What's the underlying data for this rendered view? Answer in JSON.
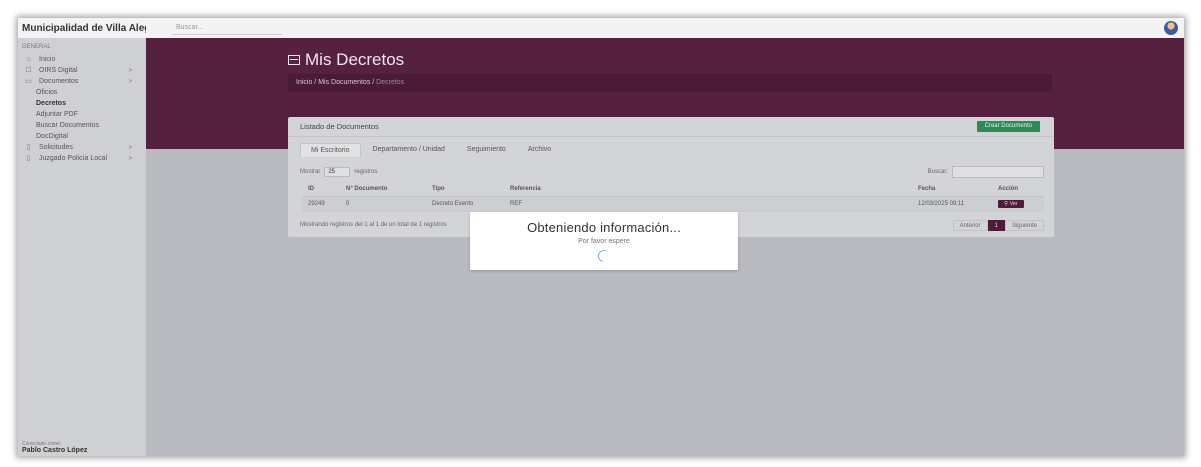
{
  "topbar": {
    "brand": "Municipalidad de Villa Alegre",
    "search_placeholder": "Buscar..."
  },
  "sidebar": {
    "section": "GENERAL",
    "items": [
      {
        "label": "Inicio",
        "icon": "home-icon"
      },
      {
        "label": "OIRS Digital",
        "icon": "inbox-icon",
        "chevron": ">"
      },
      {
        "label": "Documentos",
        "icon": "folder-icon",
        "chevron": ">"
      }
    ],
    "subitems": [
      "Oficios",
      "Decretos",
      "Adjuntar PDF",
      "Buscar Documentos",
      "DocDigital"
    ],
    "active_subitem": "Decretos",
    "items_after": [
      {
        "label": "Solicitudes",
        "icon": "file-icon",
        "chevron": ">"
      },
      {
        "label": "Juzgado Policía Local",
        "icon": "file-icon",
        "chevron": ">"
      }
    ],
    "footer_label": "Conectado como:",
    "footer_user": "Pablo Castro López"
  },
  "page": {
    "title": "Mis Decretos",
    "breadcrumb": [
      "Inicio",
      "Mis Documentos",
      "Decretos"
    ]
  },
  "card": {
    "title": "Listado de Documentos",
    "create_button": "Crear Documento",
    "tabs": [
      "Mi Escritorio",
      "Departamento / Unidad",
      "Seguimiento",
      "Archivo"
    ],
    "active_tab": "Mi Escritorio",
    "show_prefix": "Mostrar",
    "show_value": "25",
    "show_suffix": "registros",
    "search_label": "Buscar:",
    "columns": [
      "ID",
      "N° Documento",
      "Tipo",
      "Referencia",
      "Fecha",
      "Acción"
    ],
    "rows": [
      {
        "id": "29249",
        "numero": "0",
        "tipo": "Decreto Exento",
        "referencia": "REF",
        "fecha": "12/03/2025 09:11",
        "accion": "Ver"
      }
    ],
    "summary": "Mostrando registros del 1 al 1 de un total de 1 registros",
    "pager": {
      "prev": "Anterior",
      "current": "1",
      "next": "Siguiente"
    }
  },
  "modal": {
    "title": "Obteniendo información...",
    "subtitle": "Por favor espere"
  },
  "colors": {
    "banner": "#56203f",
    "accent_green": "#2e8b57",
    "action_button": "#4e1c38"
  }
}
